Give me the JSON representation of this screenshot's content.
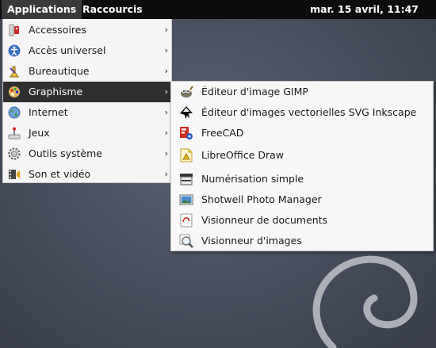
{
  "panel": {
    "applications_label": "Applications",
    "shortcuts_label": "Raccourcis",
    "clock": "mar. 15 avril, 11:47"
  },
  "menu": {
    "items": [
      {
        "label": "Accessoires",
        "icon": "accessories-icon"
      },
      {
        "label": "Accès universel",
        "icon": "accessibility-icon"
      },
      {
        "label": "Bureautique",
        "icon": "office-icon"
      },
      {
        "label": "Graphisme",
        "icon": "graphics-icon",
        "active": true
      },
      {
        "label": "Internet",
        "icon": "internet-globe-icon"
      },
      {
        "label": "Jeux",
        "icon": "games-icon"
      },
      {
        "label": "Outils système",
        "icon": "system-tools-icon"
      },
      {
        "label": "Son et vidéo",
        "icon": "sound-video-icon"
      }
    ],
    "arrow": "›"
  },
  "submenu": {
    "items": [
      {
        "label": "Éditeur d'image GIMP",
        "icon": "gimp-icon"
      },
      {
        "label": "Éditeur d'images vectorielles SVG Inkscape",
        "icon": "inkscape-icon"
      },
      {
        "label": "FreeCAD",
        "icon": "freecad-icon"
      },
      {
        "label": "LibreOffice Draw",
        "icon": "libreoffice-draw-icon"
      },
      {
        "label": "Numérisation simple",
        "icon": "scanner-icon"
      },
      {
        "label": "Shotwell Photo Manager",
        "icon": "shotwell-icon"
      },
      {
        "label": "Visionneur de documents",
        "icon": "document-viewer-icon"
      },
      {
        "label": "Visionneur d'images",
        "icon": "image-viewer-icon"
      }
    ]
  },
  "colors": {
    "panel_bg": "#0d0d0d",
    "active_item_bg": "#2f2f2f",
    "menu_bg": "#f5f5f5"
  }
}
